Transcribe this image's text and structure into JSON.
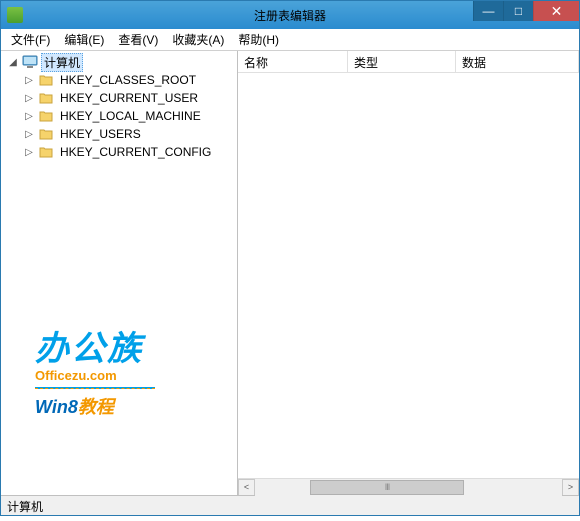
{
  "titlebar": {
    "title": "注册表编辑器"
  },
  "window_controls": {
    "min": "—",
    "max": "□",
    "close": "✕"
  },
  "menu": {
    "file": "文件(F)",
    "edit": "编辑(E)",
    "view": "查看(V)",
    "favorites": "收藏夹(A)",
    "help": "帮助(H)"
  },
  "tree": {
    "root_label": "计算机",
    "items": [
      {
        "label": "HKEY_CLASSES_ROOT"
      },
      {
        "label": "HKEY_CURRENT_USER"
      },
      {
        "label": "HKEY_LOCAL_MACHINE"
      },
      {
        "label": "HKEY_USERS"
      },
      {
        "label": "HKEY_CURRENT_CONFIG"
      }
    ]
  },
  "columns": {
    "name": "名称",
    "type": "类型",
    "data": "数据"
  },
  "scroll": {
    "left": "<",
    "right": ">",
    "thumb": "III"
  },
  "statusbar": {
    "path": "计算机"
  },
  "watermark": {
    "line1": "办公族",
    "line2": "Officezu.com",
    "line3a": "Win8",
    "line3b": "教程"
  }
}
